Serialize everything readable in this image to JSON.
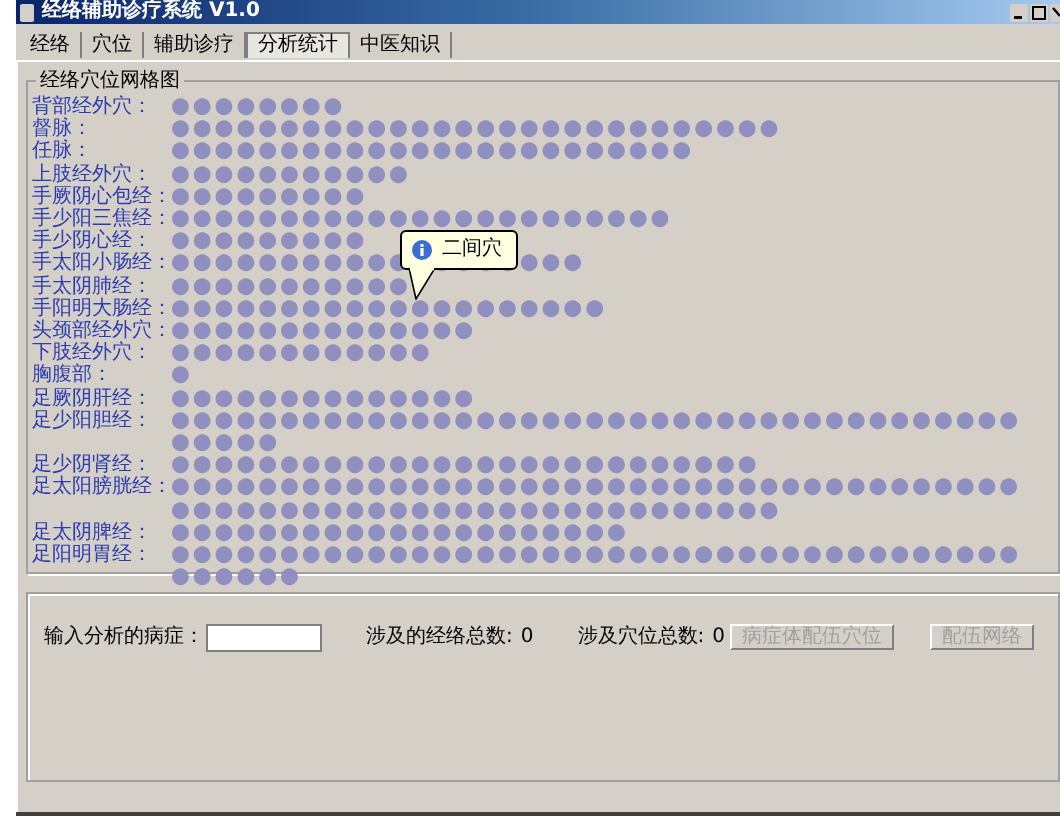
{
  "window": {
    "title": "经络辅助诊疗系统 V1.0"
  },
  "tabs": [
    {
      "label": "经络",
      "selected": false
    },
    {
      "label": "穴位",
      "selected": false
    },
    {
      "label": "辅助诊疗",
      "selected": false
    },
    {
      "label": "分析统计",
      "selected": true
    },
    {
      "label": "中医知识",
      "selected": false
    }
  ],
  "grid": {
    "title": "经络穴位网格图",
    "meridians": [
      {
        "name": "背部经外穴：",
        "points": "●●●●●●●●"
      },
      {
        "name": "督脉：",
        "points": "●●●●●●●●●●●●●●●●●●●●●●●●●●●●"
      },
      {
        "name": "任脉：",
        "points": "●●●●●●●●●●●●●●●●●●●●●●●●"
      },
      {
        "name": "上肢经外穴：",
        "points": "●●●●●●●●●●●"
      },
      {
        "name": "手厥阴心包经：",
        "points": "●●●●●●●●●"
      },
      {
        "name": "手少阳三焦经：",
        "points": "●●●●●●●●●●●●●●●●●●●●●●●"
      },
      {
        "name": "手少阴心经：",
        "points": "●●●●●●●●●"
      },
      {
        "name": "手太阳小肠经：",
        "points": "●●●●●●●●●●●●●●●●●●●"
      },
      {
        "name": "手太阴肺经：",
        "points": "●●●●●●●●●●●"
      },
      {
        "name": "手阳明大肠经：",
        "points": "●●●●●●●●●●●●●●●●●●●●"
      },
      {
        "name": "头颈部经外穴：",
        "points": "●●●●●●●●●●●●●●"
      },
      {
        "name": "下肢经外穴：",
        "points": "●●●●●●●●●●●●"
      },
      {
        "name": "胸腹部：",
        "points": "●"
      },
      {
        "name": "足厥阴肝经：",
        "points": "●●●●●●●●●●●●●●"
      },
      {
        "name": "足少阳胆经：",
        "points": "●●●●●●●●●●●●●●●●●●●●●●●●●●●●●●●●●●●●●●●●●●●●"
      },
      {
        "name": "足少阴肾经：",
        "points": "●●●●●●●●●●●●●●●●●●●●●●●●●●●"
      },
      {
        "name": "足太阳膀胱经：",
        "points": "●●●●●●●●●●●●●●●●●●●●●●●●●●●●●●●●●●●●●●●●●●●●●●●●●●●●●●●●●●●●●●●●●●●"
      },
      {
        "name": "足太阴脾经：",
        "points": "●●●●●●●●●●●●●●●●●●●●●"
      },
      {
        "name": "足阳明胃经：",
        "points": "●●●●●●●●●●●●●●●●●●●●●●●●●●●●●●●●●●●●●●●●●●●●●"
      }
    ],
    "tooltip": {
      "text": "二间穴"
    }
  },
  "analysis": {
    "input_label": "输入分析的病症：",
    "meridian_total_label": "涉及的经络总数:",
    "meridian_total": "0",
    "point_total_label": "涉及穴位总数:",
    "point_total": "0",
    "buttons": [
      {
        "label": "病症体配伍穴位",
        "disabled": true
      },
      {
        "label": "配伍网络",
        "disabled": true
      }
    ]
  }
}
